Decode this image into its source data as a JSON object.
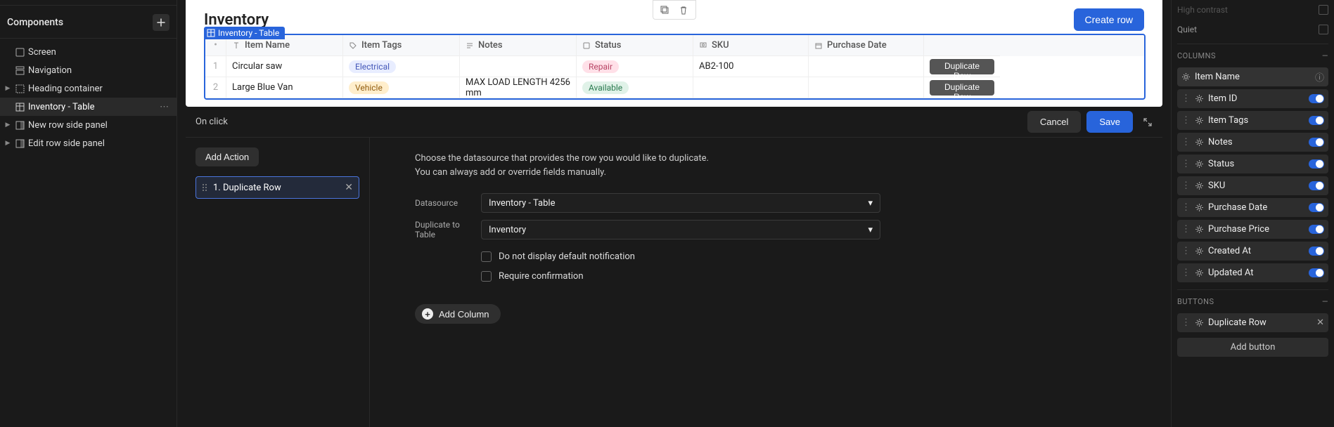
{
  "sidebar": {
    "title": "Components",
    "items": [
      {
        "label": "Screen",
        "icon": "screen-icon",
        "expandable": false,
        "indent": 0
      },
      {
        "label": "Navigation",
        "icon": "nav-icon",
        "expandable": false,
        "indent": 0
      },
      {
        "label": "Heading container",
        "icon": "container-icon",
        "expandable": true,
        "indent": 0
      },
      {
        "label": "Inventory - Table",
        "icon": "table-icon",
        "expandable": false,
        "indent": 0,
        "selected": true
      },
      {
        "label": "New row side panel",
        "icon": "panel-icon",
        "expandable": true,
        "indent": 0
      },
      {
        "label": "Edit row side panel",
        "icon": "panel-icon",
        "expandable": true,
        "indent": 0
      }
    ]
  },
  "canvas": {
    "title": "Inventory",
    "selected_tag": "Inventory - Table",
    "create_btn": "Create row",
    "table": {
      "headers": [
        "Item Name",
        "Item Tags",
        "Notes",
        "Status",
        "SKU",
        "Purchase Date"
      ],
      "rows": [
        {
          "n": "1",
          "name": "Circular saw",
          "tag": "Electrical",
          "tag_style": "electrical",
          "notes": "",
          "status": "Repair",
          "status_style": "repair",
          "sku": "AB2-100",
          "date": ""
        },
        {
          "n": "2",
          "name": "Large Blue Van",
          "tag": "Vehicle",
          "tag_style": "vehicle",
          "notes": "MAX LOAD LENGTH 4256 mm",
          "status": "Available",
          "status_style": "available",
          "sku": "",
          "date": ""
        }
      ],
      "dup_label": "Duplicate Row"
    }
  },
  "action": {
    "on_click": "On click",
    "cancel": "Cancel",
    "save": "Save",
    "add_action": "Add Action",
    "action_item": "1. Duplicate Row",
    "help_line1": "Choose the datasource that provides the row you would like to duplicate.",
    "help_line2": "You can always add or override fields manually.",
    "datasource_label": "Datasource",
    "datasource_value": "Inventory - Table",
    "duplicate_to_label": "Duplicate to Table",
    "duplicate_to_value": "Inventory",
    "checkbox1": "Do not display default notification",
    "checkbox2": "Require confirmation",
    "add_column": "Add Column"
  },
  "right": {
    "props": [
      {
        "label": "High contrast"
      },
      {
        "label": "Quiet"
      }
    ],
    "columns_title": "Columns",
    "columns": [
      {
        "label": "Item Name",
        "primary": true
      },
      {
        "label": "Item ID"
      },
      {
        "label": "Item Tags"
      },
      {
        "label": "Notes"
      },
      {
        "label": "Status"
      },
      {
        "label": "SKU"
      },
      {
        "label": "Purchase Date"
      },
      {
        "label": "Purchase Price"
      },
      {
        "label": "Created At"
      },
      {
        "label": "Updated At"
      }
    ],
    "buttons_title": "Buttons",
    "button_rows": [
      {
        "label": "Duplicate Row"
      }
    ],
    "add_button": "Add button"
  },
  "chart_data": {
    "type": "table",
    "title": "Inventory",
    "columns": [
      "Item Name",
      "Item Tags",
      "Notes",
      "Status",
      "SKU",
      "Purchase Date"
    ],
    "rows": [
      [
        "Circular saw",
        "Electrical",
        "",
        "Repair",
        "AB2-100",
        ""
      ],
      [
        "Large Blue Van",
        "Vehicle",
        "MAX LOAD LENGTH 4256 mm",
        "Available",
        "",
        ""
      ]
    ]
  }
}
